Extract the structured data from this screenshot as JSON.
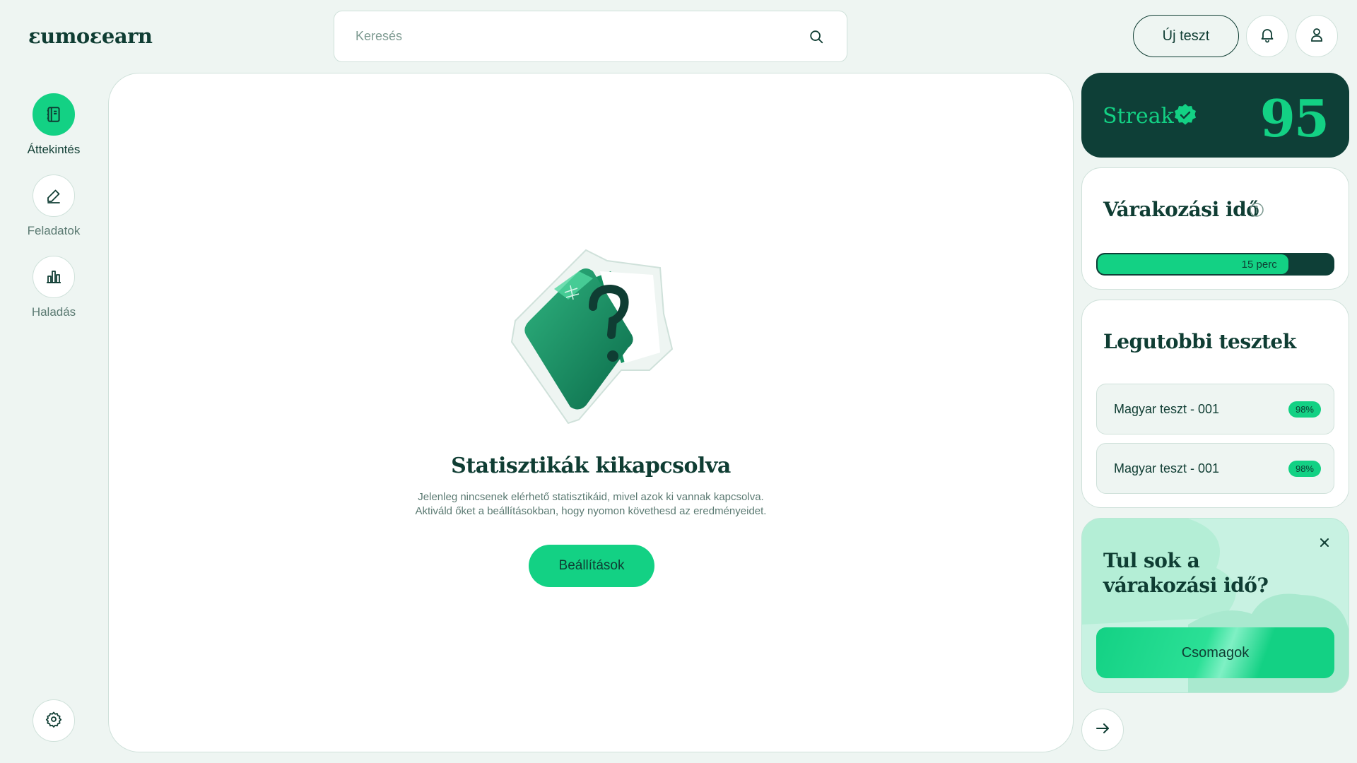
{
  "brand": {
    "logo_text": "ɛumoɛearn"
  },
  "header": {
    "search_placeholder": "Keresés",
    "new_test_label": "Új teszt"
  },
  "sidebar": {
    "items": [
      {
        "label": "Áttekintés",
        "icon": "notebook-icon",
        "active": true
      },
      {
        "label": "Feladatok",
        "icon": "pencil-icon",
        "active": false
      },
      {
        "label": "Haladás",
        "icon": "bar-chart-icon",
        "active": false
      }
    ],
    "settings_icon": "gear-icon"
  },
  "main": {
    "title": "Statisztikák kikapcsolva",
    "description_line1": "Jelenleg nincsenek elérhető statisztikáid, mivel azok ki vannak kapcsolva.",
    "description_line2": "Aktiváld őket a beállításokban, hogy nyomon követhesd az eredményeidet.",
    "button_label": "Beállítások"
  },
  "streak": {
    "label": "Streak",
    "value": "95",
    "badge_icon": "verified-badge-icon"
  },
  "waiting": {
    "title": "Várakozási idő",
    "info_icon": "info-icon",
    "progress_label": "15 perc",
    "progress_fraction": 0.81
  },
  "recent_tests": {
    "title": "Legutobbi tesztek",
    "items": [
      {
        "name": "Magyar teszt - 001",
        "score": "98%"
      },
      {
        "name": "Magyar teszt - 001",
        "score": "98%"
      }
    ]
  },
  "promo": {
    "title": "Tul sok a várakozási idő?",
    "button_label": "Csomagok"
  },
  "colors": {
    "accent": "#13d184",
    "dark": "#0e3f37",
    "text": "#0f3d33",
    "background": "#eef5f2"
  }
}
